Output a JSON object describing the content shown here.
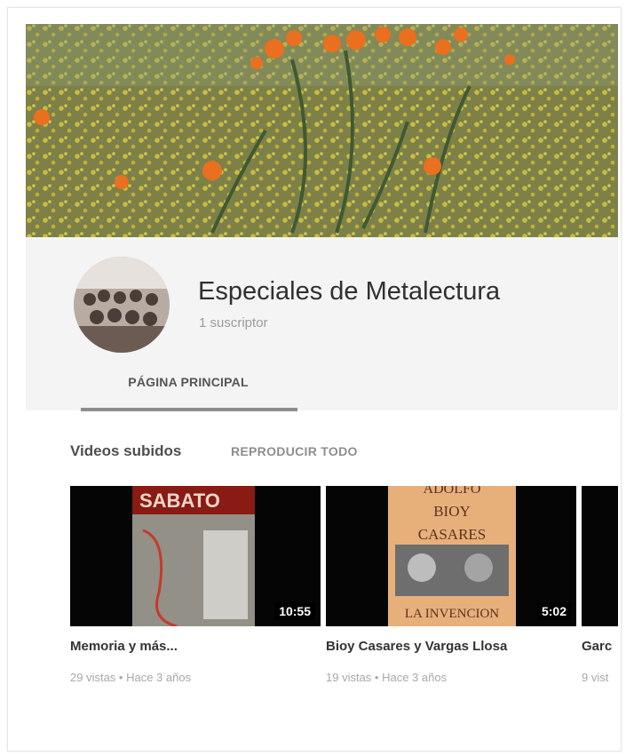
{
  "channel": {
    "name": "Especiales de Metalectura",
    "subscribers": "1 suscriptor"
  },
  "tabs": {
    "home": "PÁGINA PRINCIPAL"
  },
  "section": {
    "title": "Videos subidos",
    "play_all": "REPRODUCIR TODO"
  },
  "videos": [
    {
      "title": "Memoria y más...",
      "meta": "29 vistas • Hace 3 años",
      "duration": "10:55",
      "cover_text": "SABATO"
    },
    {
      "title": "Bioy Casares y Vargas Llosa",
      "meta": "19 vistas • Hace 3 años",
      "duration": "5:02",
      "cover_lines": [
        "ADOLFO",
        "BIOY",
        "CASARES",
        "LA INVENCION"
      ]
    },
    {
      "title": "Garc",
      "meta": "9 vist"
    }
  ],
  "colors": {
    "banner_green": "#8e8a3a",
    "flower_orange": "#ea6f1f",
    "flower_yellow": "#d9c63a",
    "book_cover": "#e7b07a"
  }
}
